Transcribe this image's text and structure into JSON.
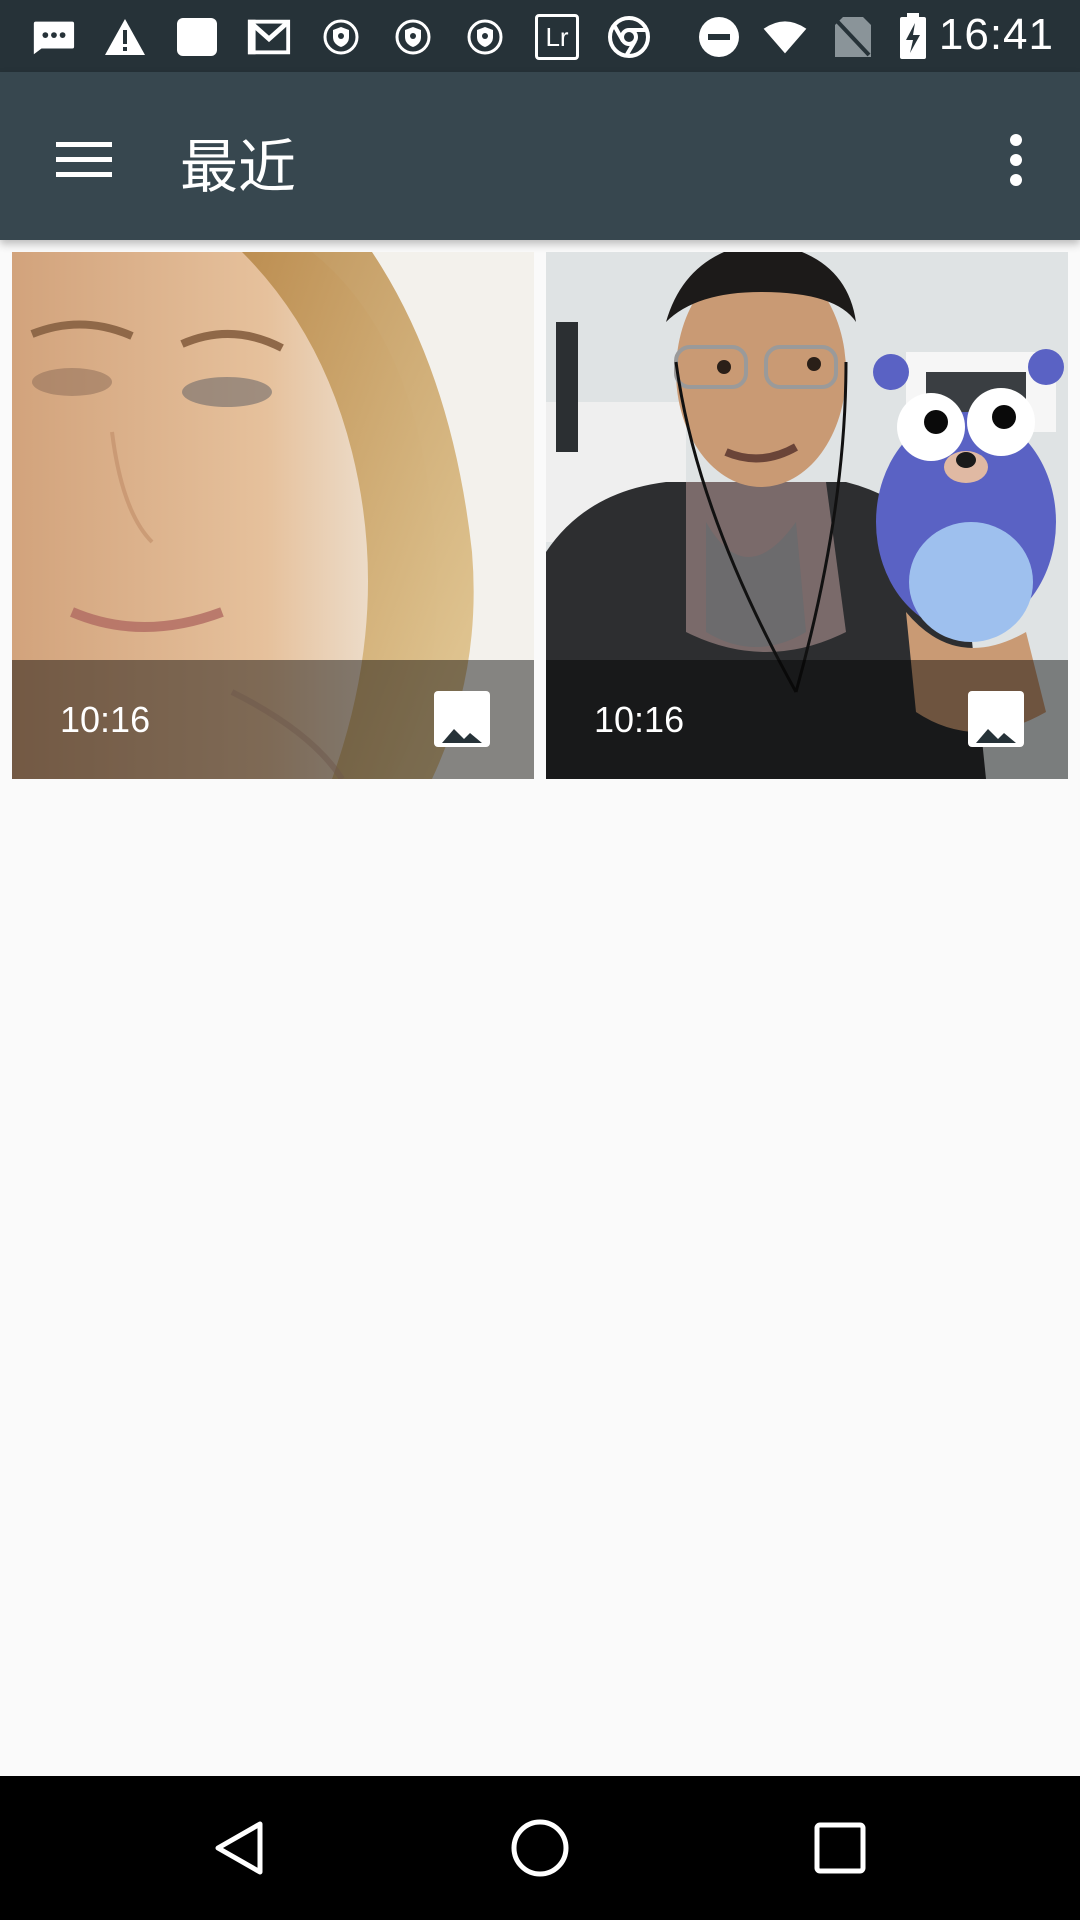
{
  "status_bar": {
    "time": "16:41",
    "icons": [
      "sms-icon",
      "warning-icon",
      "square-icon",
      "gmail-icon",
      "shield-icon",
      "shield-icon",
      "shield-icon",
      "lightroom-icon",
      "chrome-icon",
      "do-not-disturb-icon",
      "wifi-icon",
      "no-sim-icon",
      "battery-charging-icon"
    ],
    "lightroom_label": "Lr"
  },
  "app_bar": {
    "title": "最近",
    "menu_icon": "hamburger-menu-icon",
    "more_icon": "more-vert-icon",
    "background": "#37474f"
  },
  "grid": {
    "items": [
      {
        "time": "10:16",
        "type_icon": "image-icon"
      },
      {
        "time": "10:16",
        "type_icon": "image-icon"
      }
    ]
  },
  "nav_bar": {
    "buttons": [
      "back-icon",
      "home-icon",
      "recents-icon"
    ]
  }
}
